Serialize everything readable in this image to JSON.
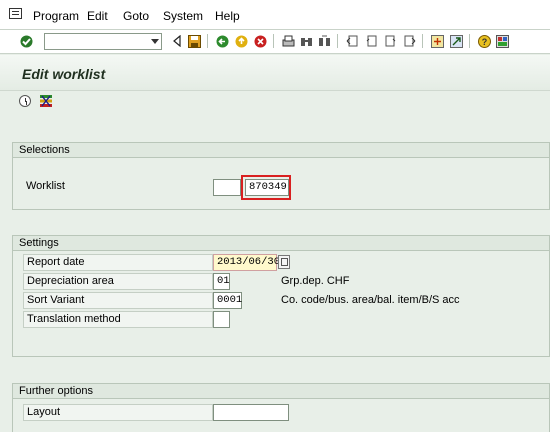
{
  "menu": {
    "items": [
      {
        "label": "Program"
      },
      {
        "label": "Edit"
      },
      {
        "label": "Goto"
      },
      {
        "label": "System"
      },
      {
        "label": "Help"
      }
    ]
  },
  "toolbar": {
    "command_value": "",
    "icons": [
      "enter-icon",
      "back-icon",
      "save-icon",
      "exit-icon",
      "cancel-icon",
      "print-icon",
      "find-icon",
      "find-next-icon",
      "first-page-icon",
      "prev-page-icon",
      "next-page-icon",
      "last-page-icon",
      "create-session-icon",
      "shortcut-icon",
      "help-icon",
      "layout-menu-icon"
    ]
  },
  "title": "Edit worklist",
  "selections": {
    "header": "Selections",
    "worklist_label": "Worklist",
    "worklist_value": "870349"
  },
  "settings": {
    "header": "Settings",
    "report_date_label": "Report date",
    "report_date_value": "2013/06/30",
    "depr_area_label": "Depreciation area",
    "depr_area_value": "01",
    "depr_area_desc": "Grp.dep. CHF",
    "sort_variant_label": "Sort Variant",
    "sort_variant_value": "0001",
    "sort_variant_desc": "Co. code/bus. area/bal. item/B/S acc",
    "translation_label": "Translation method",
    "translation_value": ""
  },
  "further": {
    "header": "Further options",
    "layout_label": "Layout",
    "layout_value": ""
  },
  "colors": {
    "background": "#e8efe8",
    "highlight": "#d92020",
    "required_field": "#fff9cc"
  }
}
